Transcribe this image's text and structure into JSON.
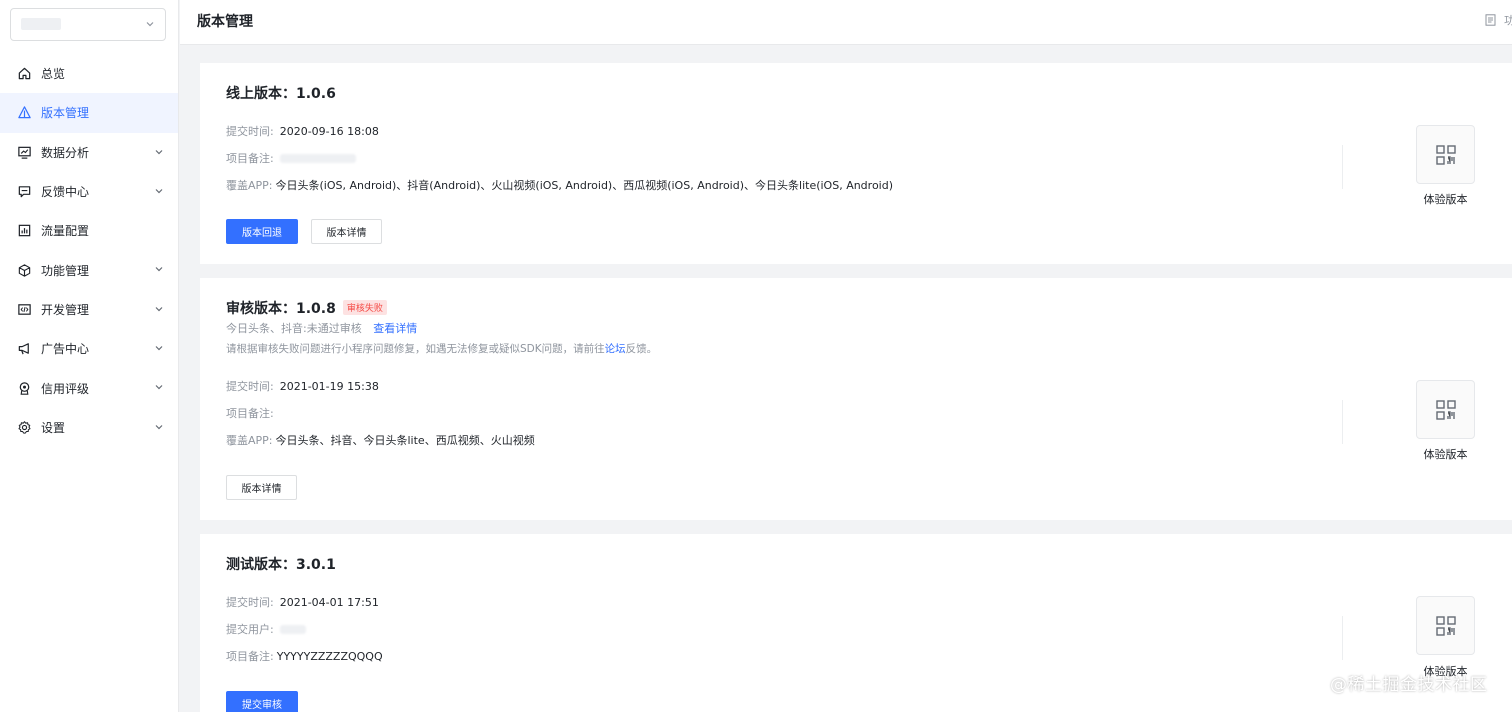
{
  "header": {
    "title": "版本管理",
    "right_text": "功能"
  },
  "sidebar": {
    "items": [
      {
        "label": "总览",
        "icon": "home-icon",
        "active": false,
        "expandable": false
      },
      {
        "label": "版本管理",
        "icon": "version-icon",
        "active": true,
        "expandable": false
      },
      {
        "label": "数据分析",
        "icon": "analytics-icon",
        "active": false,
        "expandable": true
      },
      {
        "label": "反馈中心",
        "icon": "feedback-icon",
        "active": false,
        "expandable": true
      },
      {
        "label": "流量配置",
        "icon": "traffic-icon",
        "active": false,
        "expandable": false
      },
      {
        "label": "功能管理",
        "icon": "cube-icon",
        "active": false,
        "expandable": true
      },
      {
        "label": "开发管理",
        "icon": "code-icon",
        "active": false,
        "expandable": true
      },
      {
        "label": "广告中心",
        "icon": "megaphone-icon",
        "active": false,
        "expandable": true
      },
      {
        "label": "信用评级",
        "icon": "badge-icon",
        "active": false,
        "expandable": true
      },
      {
        "label": "设置",
        "icon": "gear-icon",
        "active": false,
        "expandable": true
      }
    ]
  },
  "online": {
    "title_label": "线上版本：",
    "version": "1.0.6",
    "submit_time_label": "提交时间:",
    "submit_time": "2020-09-16 18:08",
    "remark_label": "项目备注:",
    "apps_label": "覆盖APP:",
    "apps": "今日头条(iOS, Android)、抖音(Android)、火山视频(iOS, Android)、西瓜视频(iOS, Android)、今日头条lite(iOS, Android)",
    "rollback_button": "版本回退",
    "detail_button": "版本详情",
    "qr_label": "体验版本"
  },
  "review": {
    "title_label": "审核版本：",
    "version": "1.0.8",
    "status_badge": "审核失败",
    "fail_text": "今日头条、抖音:未通过审核",
    "view_detail_link": "查看详情",
    "notice_prefix": "请根据审核失败问题进行小程序问题修复，如遇无法修复或疑似SDK问题，请前往",
    "notice_link": "论坛",
    "notice_suffix": "反馈。",
    "submit_time_label": "提交时间:",
    "submit_time": "2021-01-19 15:38",
    "remark_label": "项目备注:",
    "apps_label": "覆盖APP:",
    "apps": "今日头条、抖音、今日头条lite、西瓜视频、火山视频",
    "detail_button": "版本详情",
    "qr_label": "体验版本"
  },
  "test": {
    "title_label": "测试版本：",
    "version": "3.0.1",
    "submit_time_label": "提交时间:",
    "submit_time": "2021-04-01 17:51",
    "submit_user_label": "提交用户:",
    "remark_label": "项目备注:",
    "remark": "YYYYYZZZZZQQQQ",
    "submit_review_button": "提交审核",
    "qr_label": "体验版本"
  },
  "watermark": "@稀土掘金技术社区",
  "colors": {
    "accent": "#3370ff",
    "danger": "#f54a45",
    "danger_bg": "#fde2e2"
  }
}
